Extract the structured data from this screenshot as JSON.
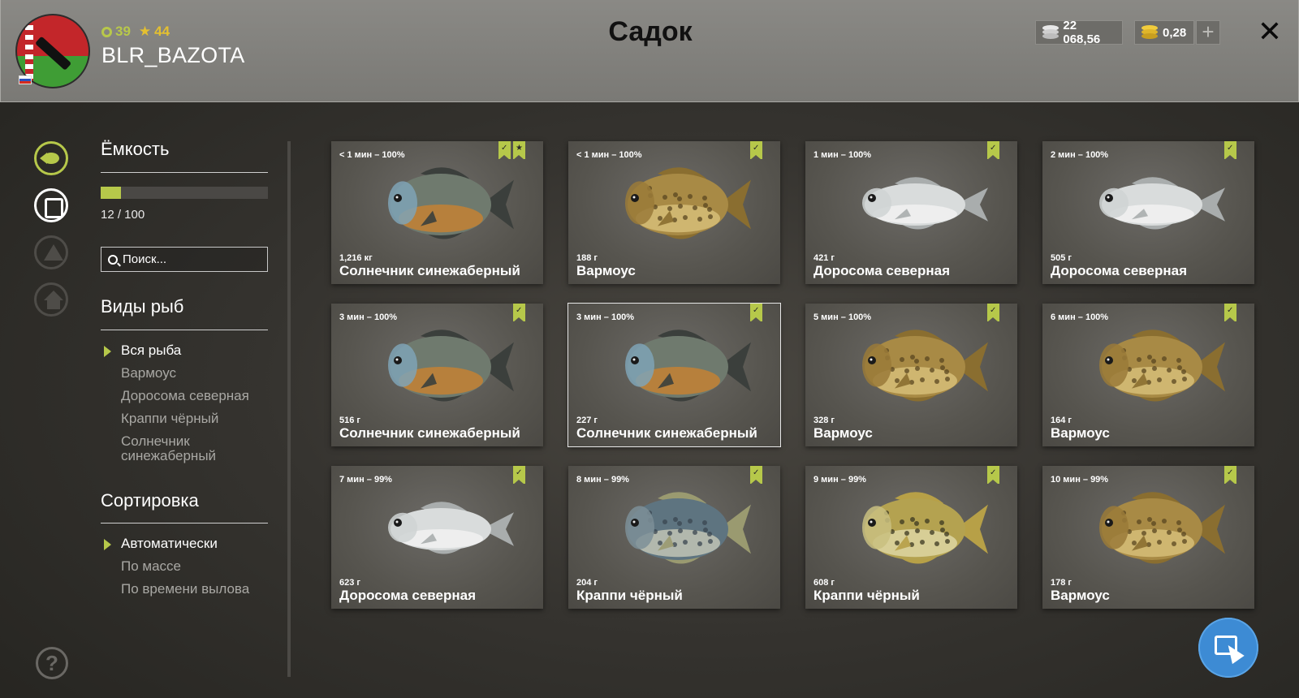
{
  "header": {
    "title": "Садок",
    "username": "BLR_BAZOTA",
    "level": "39",
    "stars": "44",
    "silver": "22 068,56",
    "gold": "0,28",
    "plus_label": "+",
    "close_label": "✕"
  },
  "sidebar": {
    "capacity_title": "Ёмкость",
    "capacity_text": "12 / 100",
    "capacity_fraction": 0.12,
    "search_placeholder": "Поиск...",
    "species_title": "Виды рыб",
    "species": [
      {
        "label": "Вся рыба",
        "active": true
      },
      {
        "label": "Вармоус",
        "active": false
      },
      {
        "label": "Доросома северная",
        "active": false
      },
      {
        "label": "Крапп­и чёрный",
        "active": false
      },
      {
        "label": "Солнечник синежаберный",
        "active": false
      }
    ],
    "sort_title": "Сортировка",
    "sort": [
      {
        "label": "Автоматически",
        "active": true
      },
      {
        "label": "По массе",
        "active": false
      },
      {
        "label": "По времени вылова",
        "active": false
      }
    ],
    "help_label": "?"
  },
  "fish": [
    {
      "time": "< 1 мин – 100%",
      "weight": "1,216 кг",
      "name": "Солнечник синежаберный",
      "kind": "bluegill",
      "trophy": true,
      "selected": false
    },
    {
      "time": "< 1 мин – 100%",
      "weight": "188 г",
      "name": "Вармоус",
      "kind": "warmouth",
      "trophy": false,
      "selected": false
    },
    {
      "time": "1 мин – 100%",
      "weight": "421 г",
      "name": "Доросома северная",
      "kind": "shad",
      "trophy": false,
      "selected": false
    },
    {
      "time": "2 мин – 100%",
      "weight": "505 г",
      "name": "Доросома северная",
      "kind": "shad",
      "trophy": false,
      "selected": false
    },
    {
      "time": "3 мин – 100%",
      "weight": "516 г",
      "name": "Солнечник синежаберный",
      "kind": "bluegill",
      "trophy": false,
      "selected": false
    },
    {
      "time": "3 мин – 100%",
      "weight": "227 г",
      "name": "Солнечник синежаберный",
      "kind": "bluegill",
      "trophy": false,
      "selected": true
    },
    {
      "time": "5 мин – 100%",
      "weight": "328 г",
      "name": "Вармоус",
      "kind": "warmouth",
      "trophy": false,
      "selected": false
    },
    {
      "time": "6 мин – 100%",
      "weight": "164 г",
      "name": "Вармоус",
      "kind": "warmouth",
      "trophy": false,
      "selected": false
    },
    {
      "time": "7 мин – 99%",
      "weight": "623 г",
      "name": "Доросома северная",
      "kind": "shad",
      "trophy": false,
      "selected": false
    },
    {
      "time": "8 мин – 99%",
      "weight": "204 г",
      "name": "Крапп­и чёрный",
      "kind": "crappie_blue",
      "trophy": false,
      "selected": false
    },
    {
      "time": "9 мин – 99%",
      "weight": "608 г",
      "name": "Крапп­и чёрный",
      "kind": "crappie",
      "trophy": false,
      "selected": false
    },
    {
      "time": "10 мин – 99%",
      "weight": "178 г",
      "name": "Вармоус",
      "kind": "warmouth",
      "trophy": false,
      "selected": false
    }
  ],
  "colors": {
    "accent": "#b6c84a",
    "stars": "#e4c030",
    "cursor_button": "#3d8bd4"
  }
}
